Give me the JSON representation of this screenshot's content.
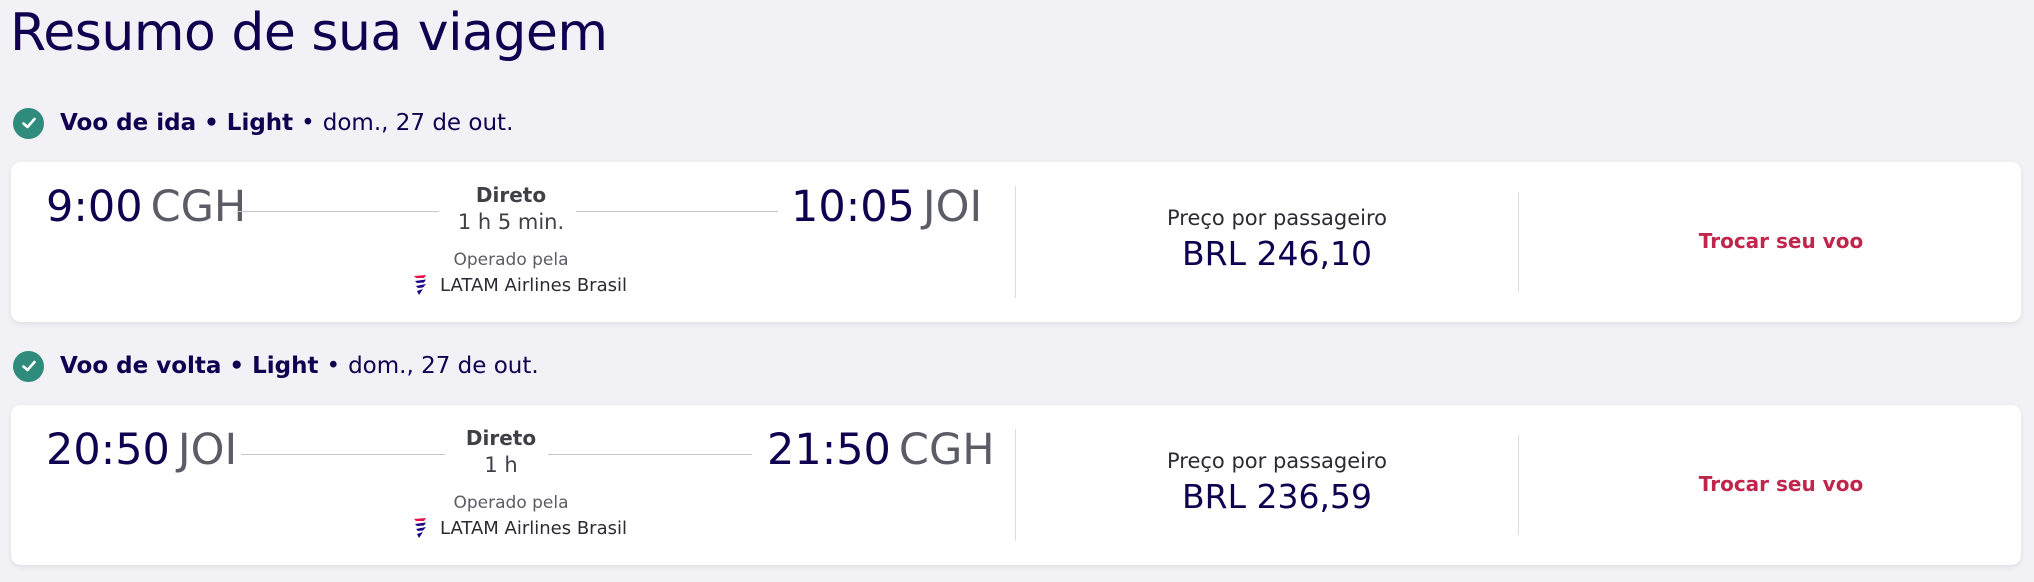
{
  "page": {
    "title": "Resumo de sua viagem"
  },
  "colors": {
    "primary": "#10004f",
    "accent": "#c0264b",
    "check": "#2f8c7d"
  },
  "legs": [
    {
      "type_label": "Voo de ida",
      "fare": "Light",
      "date": "dom., 27 de out.",
      "depart_time": "9:00",
      "depart_code": "CGH",
      "arrive_time": "10:05",
      "arrive_code": "JOI",
      "stops": "Direto",
      "duration": "1 h 5 min.",
      "operated_label": "Operado pela",
      "airline": "LATAM Airlines Brasil",
      "price_label": "Preço por passageiro",
      "price": "BRL 246,10",
      "change_label": "Trocar seu voo"
    },
    {
      "type_label": "Voo de volta",
      "fare": "Light",
      "date": "dom., 27 de out.",
      "depart_time": "20:50",
      "depart_code": "JOI",
      "arrive_time": "21:50",
      "arrive_code": "CGH",
      "stops": "Direto",
      "duration": "1 h",
      "operated_label": "Operado pela",
      "airline": "LATAM Airlines Brasil",
      "price_label": "Preço por passageiro",
      "price": "BRL 236,59",
      "change_label": "Trocar seu voo"
    }
  ],
  "icons": {
    "check": "check-icon",
    "airline_logo": "latam-logo-icon"
  }
}
